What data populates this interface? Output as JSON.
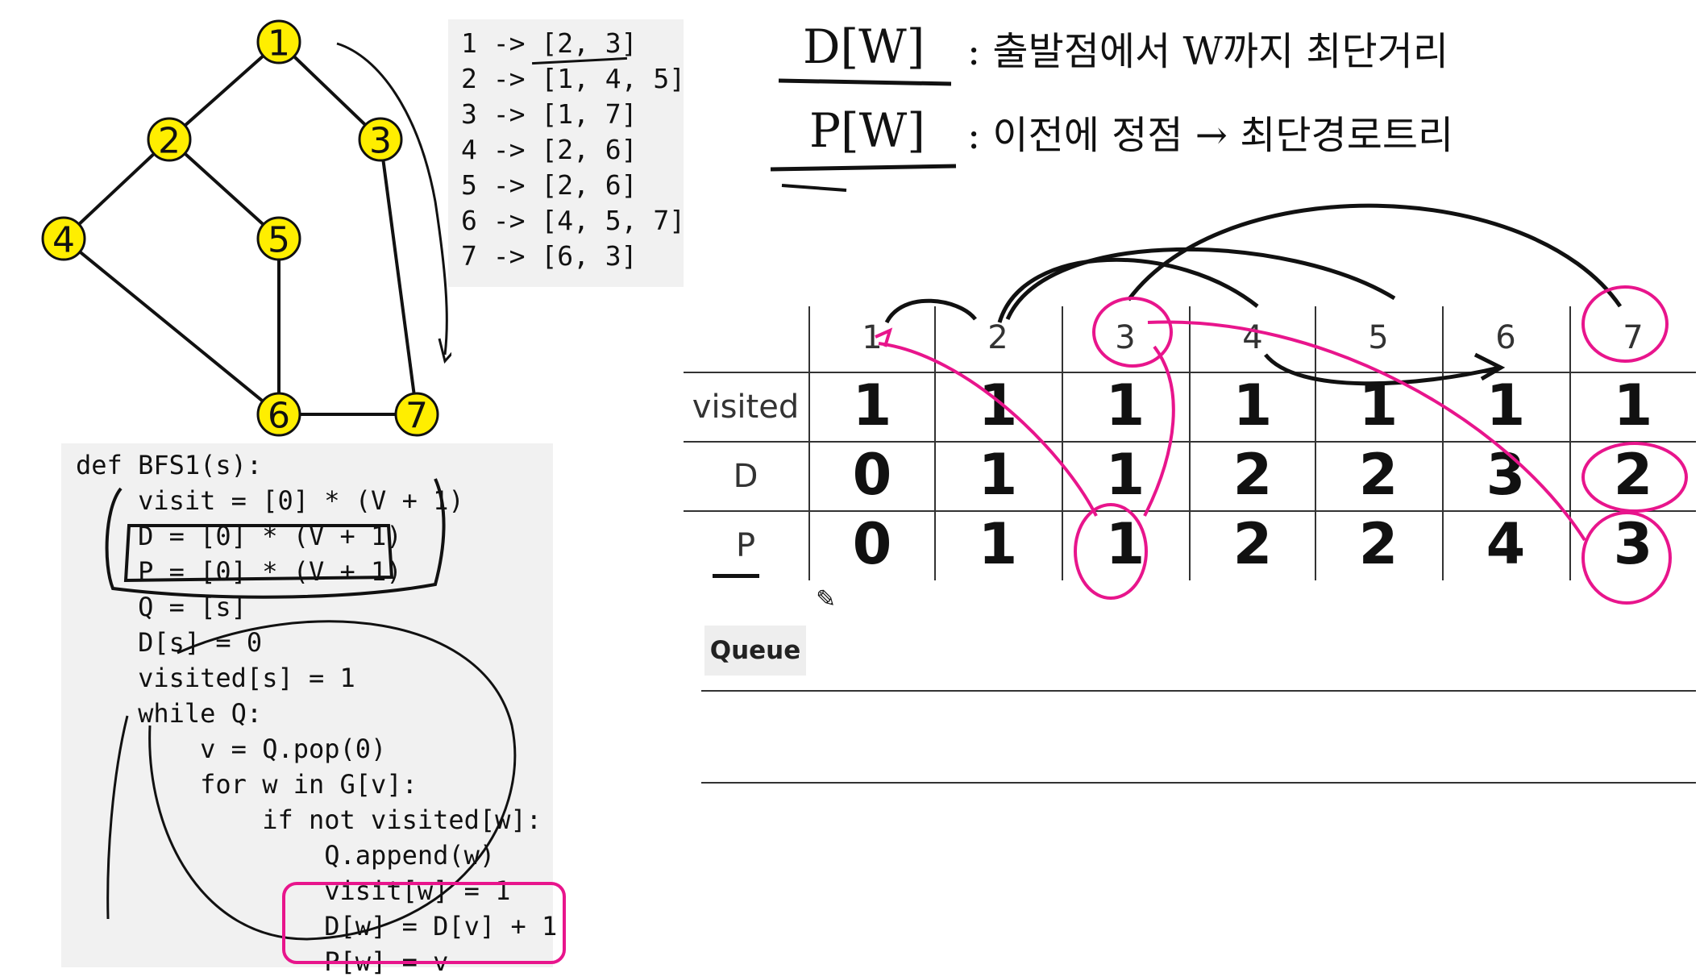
{
  "graph": {
    "nodes": [
      "1",
      "2",
      "3",
      "4",
      "5",
      "6",
      "7"
    ],
    "edges": [
      [
        "1",
        "2"
      ],
      [
        "1",
        "3"
      ],
      [
        "2",
        "4"
      ],
      [
        "2",
        "5"
      ],
      [
        "4",
        "6"
      ],
      [
        "5",
        "6"
      ],
      [
        "3",
        "7"
      ],
      [
        "6",
        "7"
      ]
    ],
    "node_color": "#ffee00",
    "node_border": "#111111"
  },
  "adjacency": [
    "1 -> [2, 3]",
    "2 -> [1, 4, 5]",
    "3 -> [1, 7]",
    "4 -> [2, 6]",
    "5 -> [2, 6]",
    "6 -> [4, 5, 7]",
    "7 -> [6, 3]"
  ],
  "code": [
    "def BFS1(s):",
    "    visit = [0] * (V + 1)",
    "    D = [0] * (V + 1)",
    "    P = [0] * (V + 1)",
    "    Q = [s]",
    "    D[s] = 0",
    "    visited[s] = 1",
    "    while Q:",
    "        v = Q.pop(0)",
    "        for w in G[v]:",
    "            if not visited[w]:",
    "                Q.append(w)",
    "                visit[w] = 1",
    "                D[w] = D[v] + 1",
    "                P[w] = v"
  ],
  "notes": {
    "line1_label": "D[W]",
    "line1_text": ": 출발점에서 W까지 최단거리",
    "line2_label": "P[W]",
    "line2_text": ": 이전에 정점 → 최단경로트리"
  },
  "table": {
    "columns": [
      "1",
      "2",
      "3",
      "4",
      "5",
      "6",
      "7"
    ],
    "rows": [
      {
        "label": "visited",
        "values": [
          "1",
          "1",
          "1",
          "1",
          "1",
          "1",
          "1"
        ]
      },
      {
        "label": "D",
        "values": [
          "0",
          "1",
          "1",
          "2",
          "2",
          "3",
          "2"
        ]
      },
      {
        "label": "P",
        "values": [
          "0",
          "1",
          "1",
          "2",
          "2",
          "4",
          "3"
        ]
      }
    ]
  },
  "queue": {
    "label": "Queue"
  },
  "colors": {
    "ink": "#111111",
    "highlight": "#e8158c"
  }
}
